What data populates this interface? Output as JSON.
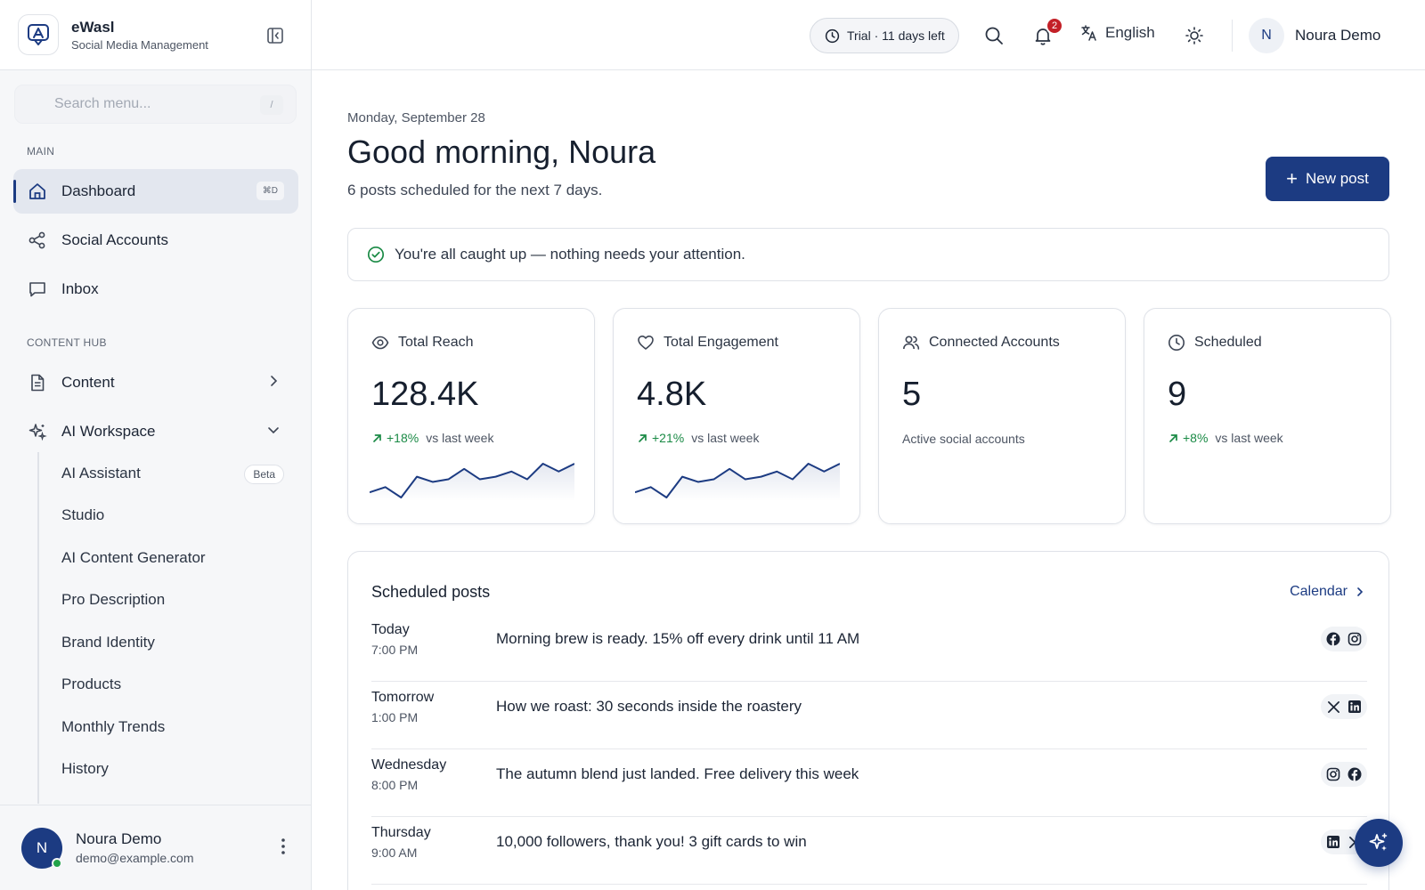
{
  "brand": {
    "name": "eWasl",
    "subtitle": "Social Media Management"
  },
  "sidebar": {
    "search_placeholder": "Search menu...",
    "search_shortcut": "/",
    "sections": {
      "main": "MAIN",
      "content_hub": "CONTENT HUB"
    },
    "items": [
      {
        "label": "Dashboard",
        "icon": "home-icon",
        "shortcut": "⌘D",
        "active": true
      },
      {
        "label": "Social Accounts",
        "icon": "share-icon"
      },
      {
        "label": "Inbox",
        "icon": "message-icon"
      },
      {
        "label": "Content",
        "icon": "document-icon"
      },
      {
        "label": "AI Workspace",
        "icon": "sparkle-icon",
        "expanded": true
      }
    ],
    "ai_sub_items": [
      {
        "label": "AI Assistant",
        "badge": "Beta"
      },
      {
        "label": "Studio"
      },
      {
        "label": "AI Content Generator"
      },
      {
        "label": "Pro Description"
      },
      {
        "label": "Brand Identity"
      },
      {
        "label": "Products"
      },
      {
        "label": "Monthly Trends"
      },
      {
        "label": "History"
      }
    ],
    "user": {
      "initial": "N",
      "name": "Noura Demo",
      "email": "demo@example.com",
      "status_color": "#22a34a"
    }
  },
  "topbar": {
    "trial": "Trial · 11 days left",
    "notifications_count": "2",
    "language": "English",
    "user_initial": "N",
    "user_name": "Noura Demo"
  },
  "main": {
    "date": "Monday, September 28",
    "greeting": "Good morning, Noura",
    "subline": "6 posts scheduled for the next 7 days.",
    "new_post_label": "New post",
    "alert": "You're all caught up — nothing needs your attention.",
    "stats": [
      {
        "title": "Total Reach",
        "icon": "eye-icon",
        "value": "128.4K",
        "delta": "+18%",
        "delta_label": "vs last week",
        "sparkline": [
          3,
          4,
          2,
          6,
          5,
          5.5,
          7.5,
          5.5,
          6,
          7,
          5.5,
          8.5,
          7,
          8.5
        ]
      },
      {
        "title": "Total Engagement",
        "icon": "heart-icon",
        "value": "4.8K",
        "delta": "+21%",
        "delta_label": "vs last week",
        "sparkline": [
          3,
          4,
          2,
          6,
          5,
          5.5,
          7.5,
          5.5,
          6,
          7,
          5.5,
          8.5,
          7,
          8.5
        ]
      },
      {
        "title": "Connected Accounts",
        "icon": "users-icon",
        "value": "5",
        "note": "Active social accounts"
      },
      {
        "title": "Scheduled",
        "icon": "clock-icon",
        "value": "9",
        "delta": "+8%",
        "delta_label": "vs last week"
      }
    ],
    "scheduled": {
      "title": "Scheduled posts",
      "calendar_link": "Calendar",
      "posts": [
        {
          "day": "Today",
          "time": "7:00 PM",
          "text": "Morning brew is ready. 15% off every drink until 11 AM",
          "platforms": [
            "facebook",
            "instagram"
          ]
        },
        {
          "day": "Tomorrow",
          "time": "1:00 PM",
          "text": "How we roast: 30 seconds inside the roastery",
          "platforms": [
            "x",
            "linkedin"
          ]
        },
        {
          "day": "Wednesday",
          "time": "8:00 PM",
          "text": "The autumn blend just landed. Free delivery this week",
          "platforms": [
            "instagram",
            "facebook"
          ]
        },
        {
          "day": "Thursday",
          "time": "9:00 AM",
          "text": "10,000 followers, thank you! 3 gift cards to win",
          "platforms": [
            "linkedin",
            "x"
          ]
        }
      ]
    }
  },
  "colors": {
    "primary": "#1c3b82",
    "success": "#1a8a45",
    "badge": "#c32027"
  }
}
